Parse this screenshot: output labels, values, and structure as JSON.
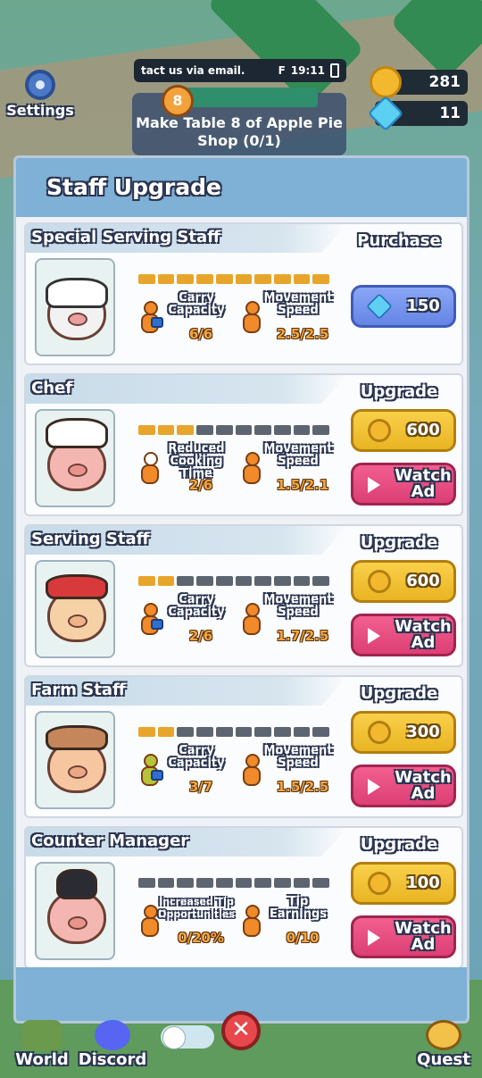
{
  "hud": {
    "settings_label": "Settings",
    "ticker_text": "tact us via email.",
    "signal": "F",
    "time": "19:11",
    "quest_number": "8",
    "quest_text": "Make Table 8 of Apple Pie Shop (0/1)",
    "coins": "281",
    "gems": "11"
  },
  "panel": {
    "title": "Staff Upgrade",
    "cards": [
      {
        "name": "Special Serving Staff",
        "level": 10,
        "max_level": 10,
        "stat1_label": "Carry Capacity",
        "stat1_value": "6/6",
        "stat2_label": "Movement Speed",
        "stat2_value": "2.5/2.5",
        "action_title": "Purchase",
        "button_value": "150",
        "button_currency": "gem"
      },
      {
        "name": "Chef",
        "level": 3,
        "max_level": 10,
        "stat1_label": "Reduced Cooking Time",
        "stat1_value": "2/6",
        "stat2_label": "Movement Speed",
        "stat2_value": "1.5/2.1",
        "action_title": "Upgrade",
        "button_value": "600",
        "button_currency": "coin",
        "ad_label": "Watch Ad"
      },
      {
        "name": "Serving Staff",
        "level": 2,
        "max_level": 10,
        "stat1_label": "Carry Capacity",
        "stat1_value": "2/6",
        "stat2_label": "Movement Speed",
        "stat2_value": "1.7/2.5",
        "action_title": "Upgrade",
        "button_value": "600",
        "button_currency": "coin",
        "ad_label": "Watch Ad"
      },
      {
        "name": "Farm Staff",
        "level": 2,
        "max_level": 10,
        "stat1_label": "Carry Capacity",
        "stat1_value": "3/7",
        "stat2_label": "Movement Speed",
        "stat2_value": "1.5/2.5",
        "action_title": "Upgrade",
        "button_value": "300",
        "button_currency": "coin",
        "ad_label": "Watch Ad"
      },
      {
        "name": "Counter Manager",
        "level": 0,
        "max_level": 10,
        "stat1_label": "Increased Tip Opportunities",
        "stat1_value": "0/20%",
        "stat2_label": "Tip Earnings",
        "stat2_value": "0/10",
        "action_title": "Upgrade",
        "button_value": "100",
        "button_currency": "coin",
        "ad_label": "Watch Ad"
      }
    ]
  },
  "bottom": {
    "world_label": "World",
    "discord_label": "Discord",
    "quest_label": "Quest"
  },
  "colors": {
    "level_on": "#e8a52c",
    "level_off": "#5d6670",
    "coin_button": "#e9b422",
    "gem_button": "#6585e6",
    "ad_button": "#dc3f74"
  }
}
